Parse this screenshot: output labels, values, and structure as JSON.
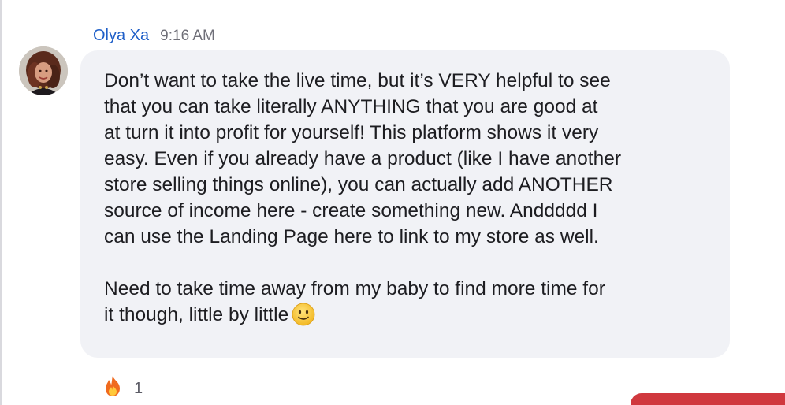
{
  "message": {
    "sender_name": "Olya Xa",
    "timestamp": "9:16 AM",
    "paragraph_1_lines": [
      "Don’t want to take the live time, but it’s VERY helpful to see",
      "that you can take literally ANYTHING that you are good at",
      "at turn it into profit for yourself! This platform shows it very",
      "easy. Even if you already have a product (like I have another",
      "store selling things online), you can actually add ANOTHER",
      "source of income here - create something new. Anddddd I",
      "can use the Landing Page here to link to my store as well."
    ],
    "paragraph_2_lines": [
      "Need to take time away from my baby to find more time for",
      "it though, little by little"
    ],
    "inline_emoji": "slightly-smiling-face-icon"
  },
  "reaction": {
    "emoji": "fire-icon",
    "count": "1"
  },
  "colors": {
    "sender_name": "#1f5fc8",
    "bubble_background": "#f1f2f6",
    "accent_red": "#d0383e"
  }
}
